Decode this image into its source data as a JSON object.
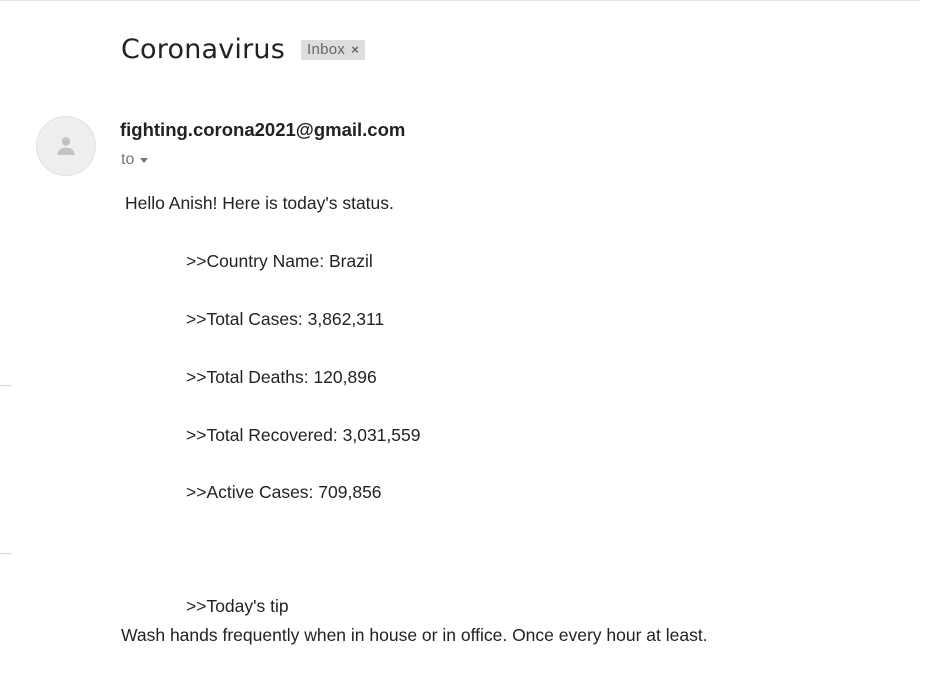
{
  "email": {
    "subject": "Coronavirus",
    "label": "Inbox",
    "label_close": "×",
    "sender": "fighting.corona2021@gmail.com",
    "to_label": "to",
    "avatar_icon": "person-icon"
  },
  "body": {
    "greeting": "Hello Anish! Here is today's status.",
    "stats": [
      ">>Country Name: Brazil",
      ">>Total Cases: 3,862,311",
      ">>Total Deaths: 120,896",
      ">>Total Recovered: 3,031,559",
      ">>Active Cases: 709,856"
    ],
    "tip_heading": ">>Today's tip",
    "tip_text": "Wash hands frequently when in house or in office. Once every hour at least."
  },
  "colors": {
    "text": "#222222",
    "muted": "#777777",
    "chip_bg": "#dddddd",
    "avatar_bg": "#eeeeee",
    "avatar_glyph": "#c2c2c2"
  }
}
